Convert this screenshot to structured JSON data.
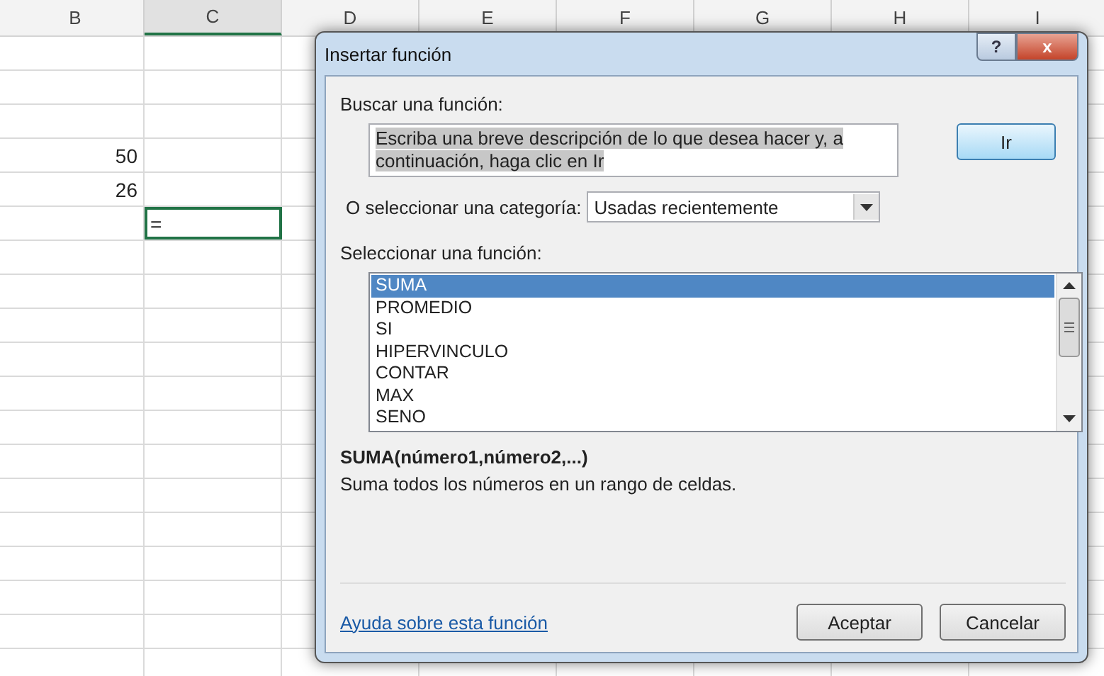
{
  "sheet": {
    "columns": [
      {
        "label": "B",
        "selected": false
      },
      {
        "label": "C",
        "selected": true
      },
      {
        "label": "D",
        "selected": false
      },
      {
        "label": "E",
        "selected": false
      },
      {
        "label": "F",
        "selected": false
      },
      {
        "label": "G",
        "selected": false
      },
      {
        "label": "H",
        "selected": false
      },
      {
        "label": "I",
        "selected": false
      }
    ],
    "rows": [
      {
        "b": "50",
        "active": false
      },
      {
        "b": "26",
        "active": false
      },
      {
        "c": "=",
        "active": true
      }
    ]
  },
  "dialog": {
    "title": "Insertar función",
    "help_button": "?",
    "close_button": "x",
    "search_label": "Buscar una función:",
    "search_value": "Escriba una breve descripción de lo que desea hacer y, a continuación, haga clic en Ir",
    "go_button": "Ir",
    "category_label": "O seleccionar una categoría:",
    "category_value": "Usadas recientemente",
    "functions_label": "Seleccionar una función:",
    "functions": [
      {
        "name": "SUMA",
        "selected": true
      },
      {
        "name": "PROMEDIO",
        "selected": false
      },
      {
        "name": "SI",
        "selected": false
      },
      {
        "name": "HIPERVINCULO",
        "selected": false
      },
      {
        "name": "CONTAR",
        "selected": false
      },
      {
        "name": "MAX",
        "selected": false
      },
      {
        "name": "SENO",
        "selected": false
      }
    ],
    "signature": "SUMA(número1,número2,...)",
    "description": "Suma todos los números en un rango de celdas.",
    "help_link": "Ayuda sobre esta función",
    "buttons": [
      "Aceptar",
      "Cancelar"
    ]
  }
}
